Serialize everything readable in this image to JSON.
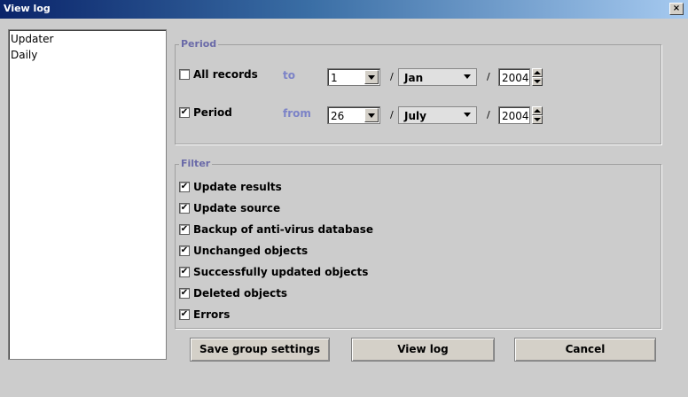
{
  "window": {
    "title": "View log",
    "close_glyph": "×"
  },
  "list": {
    "items": [
      "Updater",
      "Daily"
    ]
  },
  "period": {
    "legend": "Period",
    "all_records": {
      "label": "All records",
      "checked": false,
      "side_label": "to",
      "day": "1",
      "month": "Jan",
      "year": "2004"
    },
    "period": {
      "label": "Period",
      "checked": true,
      "side_label": "from",
      "day": "26",
      "month": "July",
      "year": "2004"
    },
    "separator": "/"
  },
  "filter": {
    "legend": "Filter",
    "items": [
      {
        "label": "Update results",
        "checked": true
      },
      {
        "label": "Update source",
        "checked": true
      },
      {
        "label": "Backup of anti-virus database",
        "checked": true
      },
      {
        "label": "Unchanged objects",
        "checked": true
      },
      {
        "label": "Successfully updated objects",
        "checked": true
      },
      {
        "label": "Deleted objects",
        "checked": true
      },
      {
        "label": "Errors",
        "checked": true
      }
    ],
    "check_glyph": "✔"
  },
  "buttons": {
    "save": "Save group settings",
    "view": "View log",
    "cancel": "Cancel"
  }
}
